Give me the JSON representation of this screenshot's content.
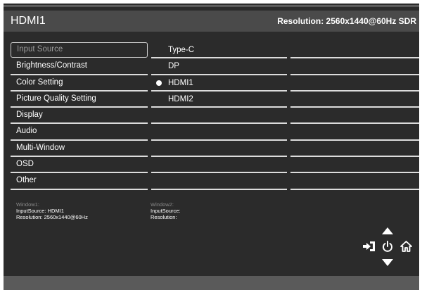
{
  "header": {
    "title": "HDMI1",
    "resolution": "Resolution: 2560x1440@60Hz SDR"
  },
  "menu": {
    "items": [
      {
        "label": "Input Source",
        "selected": true
      },
      {
        "label": "Brightness/Contrast"
      },
      {
        "label": "Color Setting"
      },
      {
        "label": "Picture Quality Setting"
      },
      {
        "label": "Display"
      },
      {
        "label": "Audio"
      },
      {
        "label": "Multi-Window"
      },
      {
        "label": "OSD"
      },
      {
        "label": "Other"
      }
    ]
  },
  "submenu": {
    "options": [
      {
        "label": "Type-C"
      },
      {
        "label": "DP"
      },
      {
        "label": "HDMI1",
        "active": true
      },
      {
        "label": "HDMI2"
      }
    ]
  },
  "window1": {
    "label": "Window1:",
    "input_source": "InputSource: HDMI1",
    "resolution": "Resolution: 2560x1440@60Hz"
  },
  "window2": {
    "label": "Window2:",
    "input_source": "InputSource:",
    "resolution": "Resolution:"
  },
  "controls": {
    "up": "up-arrow-icon",
    "down": "down-arrow-icon",
    "input": "input-source-icon",
    "power": "power-icon",
    "home": "home-icon"
  },
  "colors": {
    "background": "#2b2b2b",
    "header": "#4a4a4a",
    "footer": "#5a5a5a",
    "divider": "#dcdcdc"
  }
}
